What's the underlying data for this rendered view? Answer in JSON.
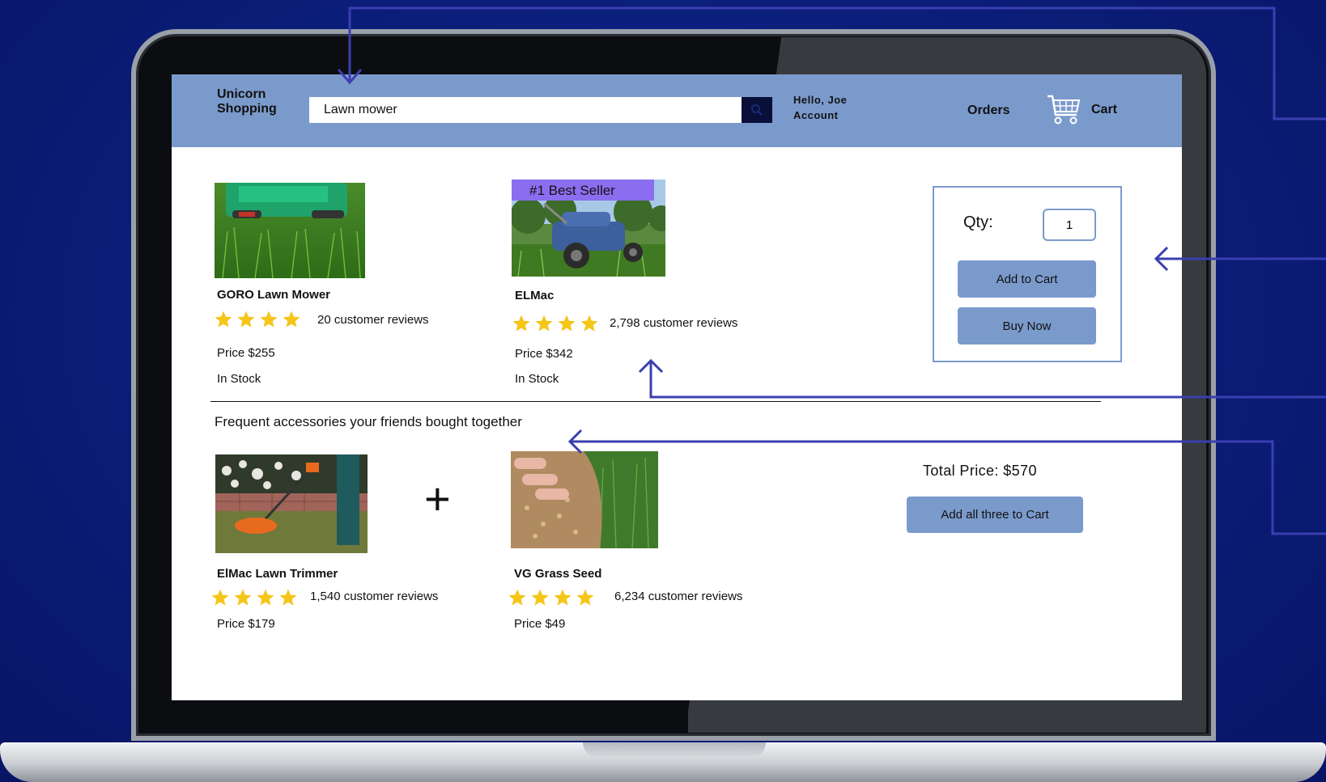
{
  "header": {
    "logo": "Unicorn\nShopping",
    "search_value": "Lawn mower",
    "greeting": "Hello, Joe",
    "account": "Account",
    "orders": "Orders",
    "cart": "Cart"
  },
  "products": [
    {
      "name": "GORO Lawn Mower",
      "rating_stars": 4,
      "reviews": "20 customer reviews",
      "price": "Price $255",
      "stock": "In Stock"
    },
    {
      "name": "ELMac",
      "badge": "#1 Best Seller",
      "rating_stars": 4,
      "reviews": "2,798 customer reviews",
      "price": "Price $342",
      "stock": "In Stock"
    }
  ],
  "buybox": {
    "qty_label": "Qty:",
    "qty_value": "1",
    "add_to_cart": "Add to Cart",
    "buy_now": "Buy Now"
  },
  "accessories": {
    "title": "Frequent accessories your friends bought together",
    "items": [
      {
        "name": "ElMac Lawn Trimmer",
        "rating_stars": 4,
        "reviews": "1,540 customer reviews",
        "price": "Price $179"
      },
      {
        "name": "VG Grass Seed",
        "rating_stars": 4,
        "reviews": "6,234 customer reviews",
        "price": "Price $49"
      }
    ],
    "plus": "+",
    "total": "Total Price: $570",
    "add_all": "Add all three to Cart"
  },
  "colors": {
    "header": "#7b9acc",
    "accent_line": "#3b3fb0",
    "badge": "#8b6ef0",
    "star": "#f5c518",
    "background": "#0b1f7d"
  }
}
